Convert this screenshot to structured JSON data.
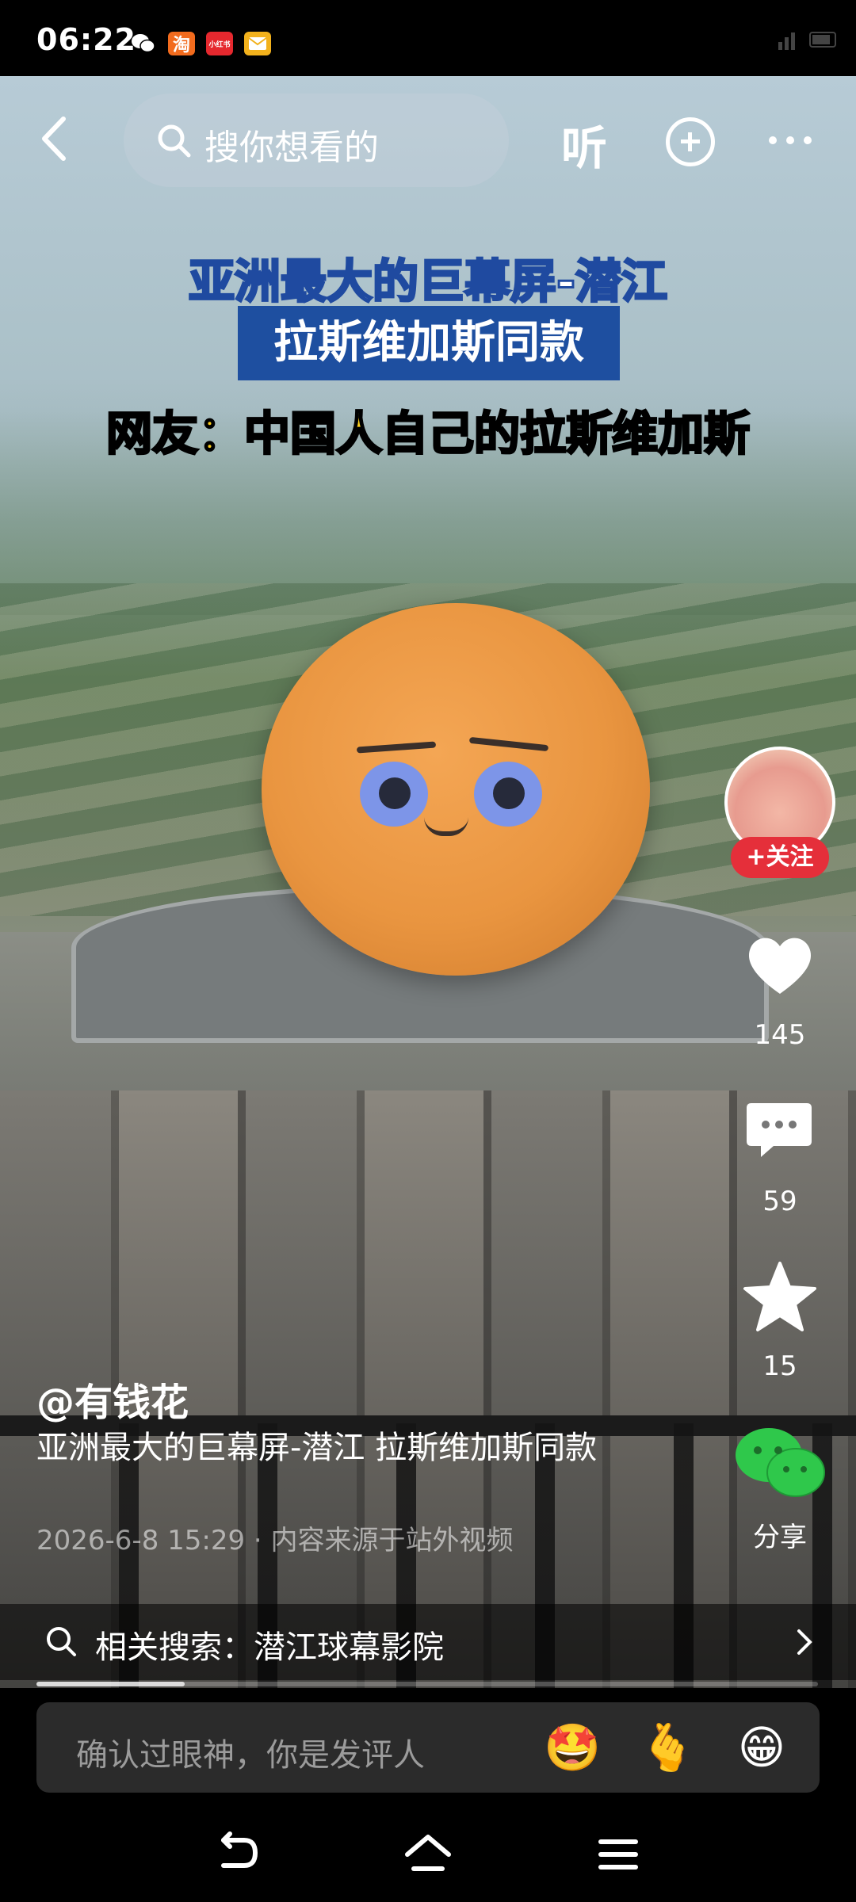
{
  "status_bar": {
    "time": "06:22",
    "icons": [
      {
        "name": "wechat-icon",
        "color": "#ffffff"
      },
      {
        "name": "taobao-icon",
        "glyph": "淘",
        "color": "#f26b1d"
      },
      {
        "name": "xiaohongshu-icon",
        "glyph": "小红书",
        "color": "#e5282e"
      },
      {
        "name": "mail-icon",
        "color": "#f2b11c"
      }
    ]
  },
  "top_bar": {
    "search_placeholder": "搜你想看的",
    "listen_label": "听"
  },
  "video_caption": {
    "line1": "亚洲最大的巨幕屏-潜江",
    "line2": "拉斯维加斯同款",
    "line3": "网友：中国人自己的拉斯维加斯"
  },
  "actions": {
    "follow_label": "+关注",
    "like_count": "145",
    "comment_count": "59",
    "favorite_count": "15",
    "share_label": "分享"
  },
  "post": {
    "author": "@有钱花",
    "description": "亚洲最大的巨幕屏-潜江 拉斯维加斯同款",
    "meta": "2026-6-8 15:29 · 内容来源于站外视频"
  },
  "related_search": {
    "text": "相关搜索：潜江球幕影院"
  },
  "playback": {
    "progress_fraction": 0.19
  },
  "comment_bar": {
    "placeholder": "确认过眼神，你是发评人",
    "emojis": [
      "🤩",
      "🫰",
      "😁"
    ]
  },
  "colors": {
    "follow_red": "#e52f3a",
    "caption_yellow": "#ffd21e",
    "caption_blue": "#1e4fa0"
  }
}
